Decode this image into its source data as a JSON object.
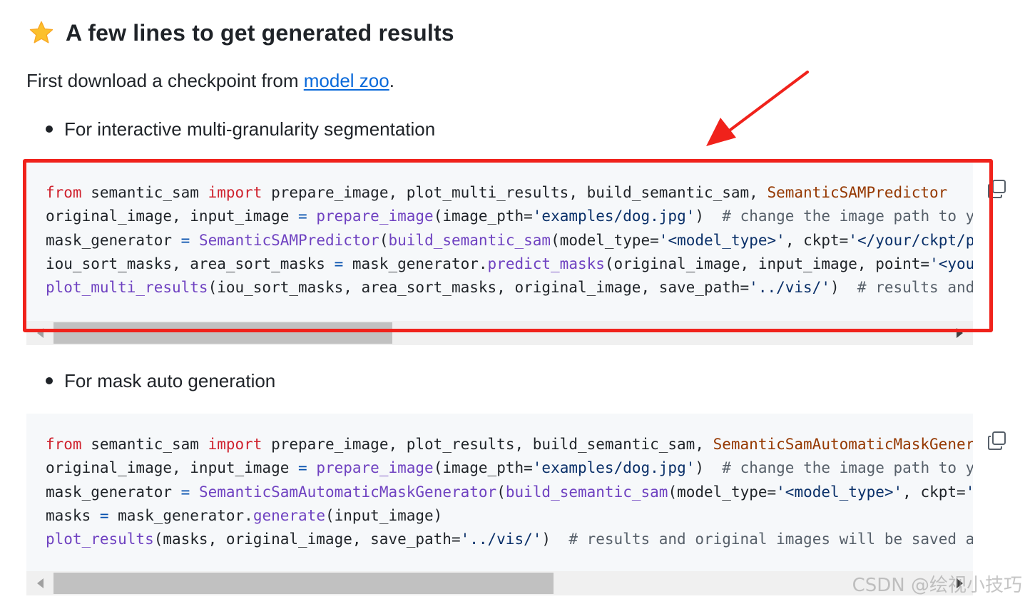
{
  "heading": {
    "title": "A few lines to get generated results"
  },
  "intro": {
    "prefix": "First download a checkpoint from ",
    "link": "model zoo",
    "suffix": "."
  },
  "bullets": [
    "For interactive multi-granularity segmentation",
    "For mask auto generation"
  ],
  "code_blocks": [
    {
      "lines": [
        [
          [
            "kw",
            "from"
          ],
          [
            "tx",
            " semantic_sam "
          ],
          [
            "kw",
            "import"
          ],
          [
            "tx",
            " prepare_image, plot_multi_results, build_semantic_sam, "
          ],
          [
            "cls",
            "SemanticSAMPredictor"
          ]
        ],
        [
          [
            "tx",
            "original_image, input_image "
          ],
          [
            "op",
            "="
          ],
          [
            "tx",
            " "
          ],
          [
            "fn",
            "prepare_image"
          ],
          [
            "tx",
            "(image_pth="
          ],
          [
            "str",
            "'examples/dog.jpg'"
          ],
          [
            "tx",
            ")  "
          ],
          [
            "cm",
            "# change the image path to y"
          ]
        ],
        [
          [
            "tx",
            "mask_generator "
          ],
          [
            "op",
            "="
          ],
          [
            "tx",
            " "
          ],
          [
            "fn",
            "SemanticSAMPredictor"
          ],
          [
            "tx",
            "("
          ],
          [
            "fn",
            "build_semantic_sam"
          ],
          [
            "tx",
            "(model_type="
          ],
          [
            "str",
            "'<model_type>'"
          ],
          [
            "tx",
            ", ckpt="
          ],
          [
            "str",
            "'</your/ckpt/p"
          ]
        ],
        [
          [
            "tx",
            "iou_sort_masks, area_sort_masks "
          ],
          [
            "op",
            "="
          ],
          [
            "tx",
            " mask_generator."
          ],
          [
            "fn",
            "predict_masks"
          ],
          [
            "tx",
            "(original_image, input_image, point="
          ],
          [
            "str",
            "'<you"
          ]
        ],
        [
          [
            "fn",
            "plot_multi_results"
          ],
          [
            "tx",
            "(iou_sort_masks, area_sort_masks, original_image, save_path="
          ],
          [
            "str",
            "'../vis/'"
          ],
          [
            "tx",
            ")  "
          ],
          [
            "cm",
            "# results and"
          ]
        ]
      ],
      "scroll_fraction": 0.38
    },
    {
      "lines": [
        [
          [
            "kw",
            "from"
          ],
          [
            "tx",
            " semantic_sam "
          ],
          [
            "kw",
            "import"
          ],
          [
            "tx",
            " prepare_image, plot_results, build_semantic_sam, "
          ],
          [
            "cls",
            "SemanticSamAutomaticMaskGener"
          ]
        ],
        [
          [
            "tx",
            "original_image, input_image "
          ],
          [
            "op",
            "="
          ],
          [
            "tx",
            " "
          ],
          [
            "fn",
            "prepare_image"
          ],
          [
            "tx",
            "(image_pth="
          ],
          [
            "str",
            "'examples/dog.jpg'"
          ],
          [
            "tx",
            ")  "
          ],
          [
            "cm",
            "# change the image path to y"
          ]
        ],
        [
          [
            "tx",
            "mask_generator "
          ],
          [
            "op",
            "="
          ],
          [
            "tx",
            " "
          ],
          [
            "fn",
            "SemanticSamAutomaticMaskGenerator"
          ],
          [
            "tx",
            "("
          ],
          [
            "fn",
            "build_semantic_sam"
          ],
          [
            "tx",
            "(model_type="
          ],
          [
            "str",
            "'<model_type>'"
          ],
          [
            "tx",
            ", ckpt="
          ],
          [
            "str",
            "'"
          ]
        ],
        [
          [
            "tx",
            "masks "
          ],
          [
            "op",
            "="
          ],
          [
            "tx",
            " mask_generator."
          ],
          [
            "fn",
            "generate"
          ],
          [
            "tx",
            "(input_image)"
          ]
        ],
        [
          [
            "fn",
            "plot_results"
          ],
          [
            "tx",
            "(masks, original_image, save_path="
          ],
          [
            "str",
            "'../vis/'"
          ],
          [
            "tx",
            ")  "
          ],
          [
            "cm",
            "# results and original images will be saved a"
          ]
        ]
      ],
      "scroll_fraction": 0.56
    }
  ],
  "icons": {
    "heading": "star-icon",
    "copy": "copy-icon"
  },
  "colors": {
    "link": "#0969da",
    "annotation": "#f0221b",
    "code_bg": "#f6f8fa"
  },
  "watermark": "CSDN @绘视小技巧"
}
